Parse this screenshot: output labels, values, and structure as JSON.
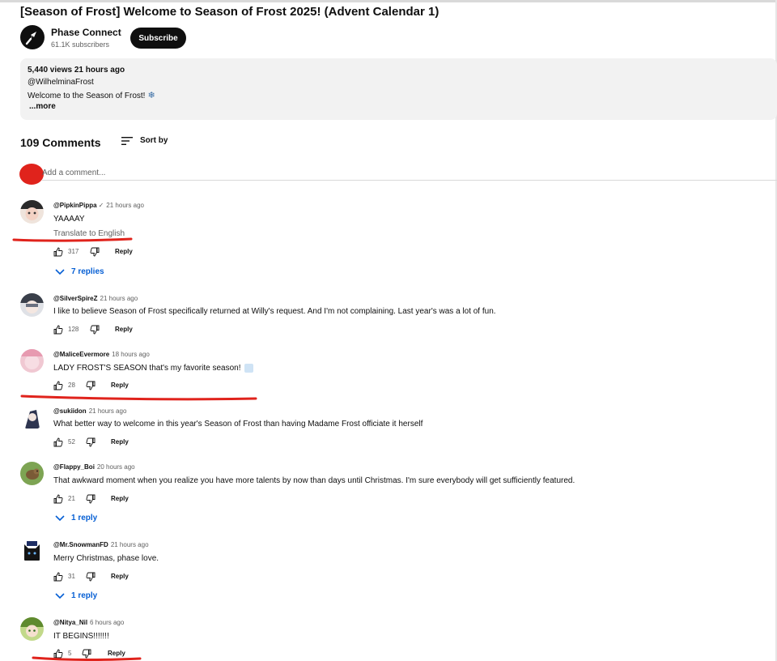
{
  "video": {
    "title": "[Season of Frost] Welcome to Season of Frost 2025! (Advent Calendar 1)"
  },
  "channel": {
    "name": "Phase Connect",
    "subscribers": "61.1K subscribers",
    "subscribe_label": "Subscribe"
  },
  "description": {
    "stats": "5,440 views  21 hours ago",
    "line1": "@WilhelminaFrost",
    "line2": "Welcome to the Season of Frost!",
    "line2_icon": "snowflake-icon",
    "more_label": "...more"
  },
  "comments_header": {
    "count": "109 Comments",
    "sort_label": "Sort by",
    "add_placeholder": "Add a comment..."
  },
  "comments": [
    {
      "author": "@PipkinPippa",
      "verified": true,
      "check": "✓",
      "time": "21 hours ago",
      "text": "YAAAAY",
      "translate": "Translate to English",
      "likes": "317",
      "reply_label": "Reply",
      "replies": "7 replies"
    },
    {
      "author": "@SilverSpireZ",
      "time": "21 hours ago",
      "text": "I like to believe Season of Frost specifically returned at Willy's request. And I'm not complaining. Last year's was a lot of fun.",
      "likes": "128",
      "reply_label": "Reply"
    },
    {
      "author": "@MaliceEvermore",
      "time": "18 hours ago",
      "text": "LADY FROST'S SEASON that's my favorite season!",
      "text_icon": "snowflake-emoji",
      "likes": "28",
      "reply_label": "Reply"
    },
    {
      "author": "@sukiidon",
      "time": "21 hours ago",
      "text": "What better way to welcome in this year's Season of Frost than having Madame Frost officiate it herself",
      "likes": "52",
      "reply_label": "Reply"
    },
    {
      "author": "@Flappy_Boi",
      "time": "20 hours ago",
      "text": "That awkward moment when you realize you have more talents by now than days until Christmas. I'm sure everybody will get sufficiently featured.",
      "likes": "21",
      "reply_label": "Reply",
      "replies": "1 reply"
    },
    {
      "author": "@Mr.SnowmanFD",
      "time": "21 hours ago",
      "text": "Merry Christmas, phase love.",
      "likes": "31",
      "reply_label": "Reply",
      "replies": "1 reply"
    },
    {
      "author": "@Nitya_Nil",
      "time": "6 hours ago",
      "text": "IT BEGINS!!!!!!!",
      "likes": "5",
      "reply_label": "Reply"
    }
  ],
  "colors": {
    "accent_blue": "#065fd4",
    "annotation_red": "#e0231c",
    "description_bg": "#f2f2f2"
  }
}
